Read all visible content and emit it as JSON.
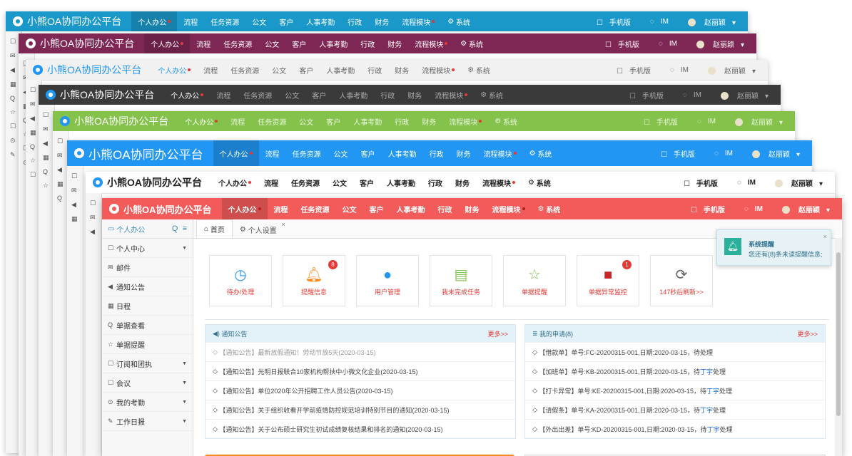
{
  "brand": "小熊OA协同办公平台",
  "menu": [
    "个人办公",
    "流程",
    "任务资源",
    "公文",
    "客户",
    "人事考勤",
    "行政",
    "财务",
    "流程模块",
    "系统"
  ],
  "right_menu": [
    "手机版",
    "IM",
    "赵丽颖"
  ],
  "themes": {
    "blue": "#1a98c9",
    "purple": "#7e2654",
    "light": "#f1f1f1",
    "dark": "#3a3a3a",
    "green": "#84c24c",
    "sky": "#2196f3",
    "white": "#ffffff",
    "red": "#f35b5b"
  },
  "sidebar": {
    "title": "个人办公",
    "items": [
      "个人中心",
      "邮件",
      "通知公告",
      "日程",
      "单据查看",
      "单据提醒",
      "订阅和团执",
      "会议",
      "我的考勤",
      "工作日报"
    ]
  },
  "tabs": [
    "首页",
    "个人设置"
  ],
  "tiles": [
    {
      "label": "待办/处理",
      "icon": "clock-icon",
      "color": "#2196f3"
    },
    {
      "label": "提醒信息",
      "icon": "bell-icon",
      "color": "#f68b1f",
      "badge": "8"
    },
    {
      "label": "用户管理",
      "icon": "user-icon",
      "color": "#2196f3"
    },
    {
      "label": "我未完成任务",
      "icon": "book-icon",
      "color": "#84c24c"
    },
    {
      "label": "单据提醒",
      "icon": "star-icon",
      "color": "#84c24c"
    },
    {
      "label": "单据异常监控",
      "icon": "briefcase-icon",
      "color": "#c62828",
      "badge": "1"
    },
    {
      "label": "147秒后刷新>>",
      "icon": "refresh-icon",
      "color": "#616161"
    }
  ],
  "notices": {
    "title": "通知公告",
    "more": "更多>>",
    "items": [
      "【通知公告】最新放假通知！劳动节放5天(2020-03-15)",
      "【通知公告】光明日报联合10家机构帮扶中小微文化企业(2020-03-15)",
      "【通知公告】单位2020年公开招聘工作人员公告(2020-03-15)",
      "【通知公告】关于组织收看开学前疫情防控规范培训特别节目的通知(2020-03-15)",
      "【通知公告】关于公布硕士研究生初试成绩复核结果和排名的通知(2020-03-15)"
    ]
  },
  "applications": {
    "title": "我的申请(8)",
    "more": "更多>>",
    "items": [
      {
        "text": "【借款单】单号:FC-20200315-001,日期:2020-03-15，待处理",
        "who": ""
      },
      {
        "text": "【加班单】单号:KB-20200315-001,日期:2020-03-15，待",
        "who": "丁宇",
        "tail": "处理"
      },
      {
        "text": "【打卡异常】单号:KE-20200315-001,日期:2020-03-15，待",
        "who": "丁宇",
        "tail": "处理"
      },
      {
        "text": "【请假条】单号:KA-20200315-001,日期:2020-03-15，待",
        "who": "丁宇",
        "tail": "处理"
      },
      {
        "text": "【外出出差】单号:KD-20200315-001,日期:2020-03-15，待",
        "who": "丁宇",
        "tail": "处理"
      }
    ]
  },
  "toast": {
    "title": "系统提醒",
    "body": "您还有(8)条未读提醒信息;"
  }
}
